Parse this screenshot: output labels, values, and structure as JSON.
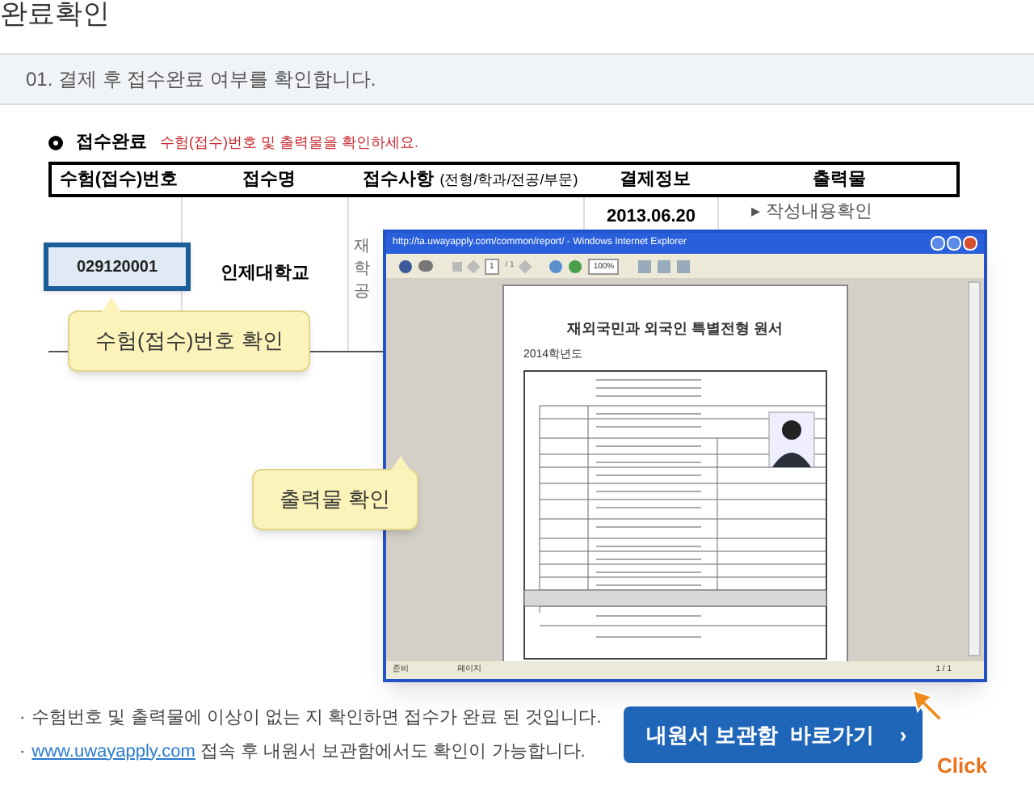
{
  "page_title": "완료확인",
  "step": "01. 결제  후 접수완료 여부를 확인합니다.",
  "section": {
    "label": "접수완료",
    "note": "수험(접수)번호 및 출력물을 확인하세요."
  },
  "table": {
    "columns": [
      {
        "label": "수험(접수)번호"
      },
      {
        "label": "접수명"
      },
      {
        "label": "접수사항",
        "sub": "(전형/학과/전공/부문)"
      },
      {
        "label": "결제정보"
      },
      {
        "label": "출력물"
      }
    ],
    "row": {
      "number": "029120001",
      "name": "인제대학교",
      "column_3": [
        "재",
        "학",
        "공"
      ],
      "payment": "2013.06.20",
      "output": "▸ 작성내용확인"
    }
  },
  "callouts": [
    "수험(접수)번호 확인",
    "출력물 확인"
  ],
  "viewer": {
    "title": "http://ta.uwayapply.com/common/report/ - Windows Internet Explorer",
    "page": "1",
    "pages": "/ 1",
    "zoom": "100%",
    "doc_title": "재외국민과 외국인 특별전형 원서",
    "doc_year": "2014학년도",
    "status": [
      "준비",
      "페이지",
      "1 / 1"
    ]
  },
  "notes": [
    {
      "bullet": "·",
      "text": "수험번호 및 출력물에 이상이 없는 지 확인하면 접수가 완료 된 것입니다."
    },
    {
      "bullet": "·",
      "link": "www.uwayapply.com",
      "text": " 접속 후 내원서 보관함에서도 확인이 가능합니다."
    }
  ],
  "button": {
    "label": "내원서 보관함  바로가기",
    "arrow": "›"
  },
  "click": "Click"
}
